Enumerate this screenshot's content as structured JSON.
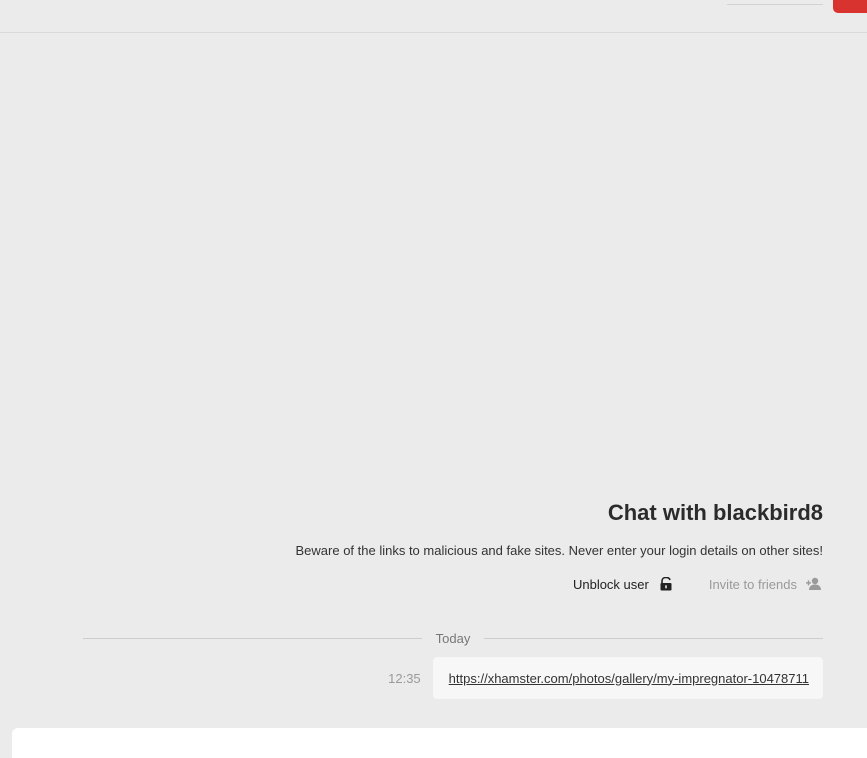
{
  "chat": {
    "title": "Chat with blackbird8",
    "warning": "Beware of the links to malicious and fake sites. Never enter your login details on other sites!"
  },
  "actions": {
    "invite_label": "Invite to friends",
    "invite_icon": "add-user-icon",
    "unblock_label": "Unblock user",
    "unblock_icon": "unlock-icon"
  },
  "messages": {
    "date_label": "Today",
    "items": [
      {
        "text": "https://xhamster.com/photos/gallery/my-impregnator-10478711",
        "time": "12:35"
      }
    ]
  },
  "colors": {
    "background": "#ebebeb",
    "bubble": "#f7f7f7",
    "accent": "#d9332f"
  }
}
